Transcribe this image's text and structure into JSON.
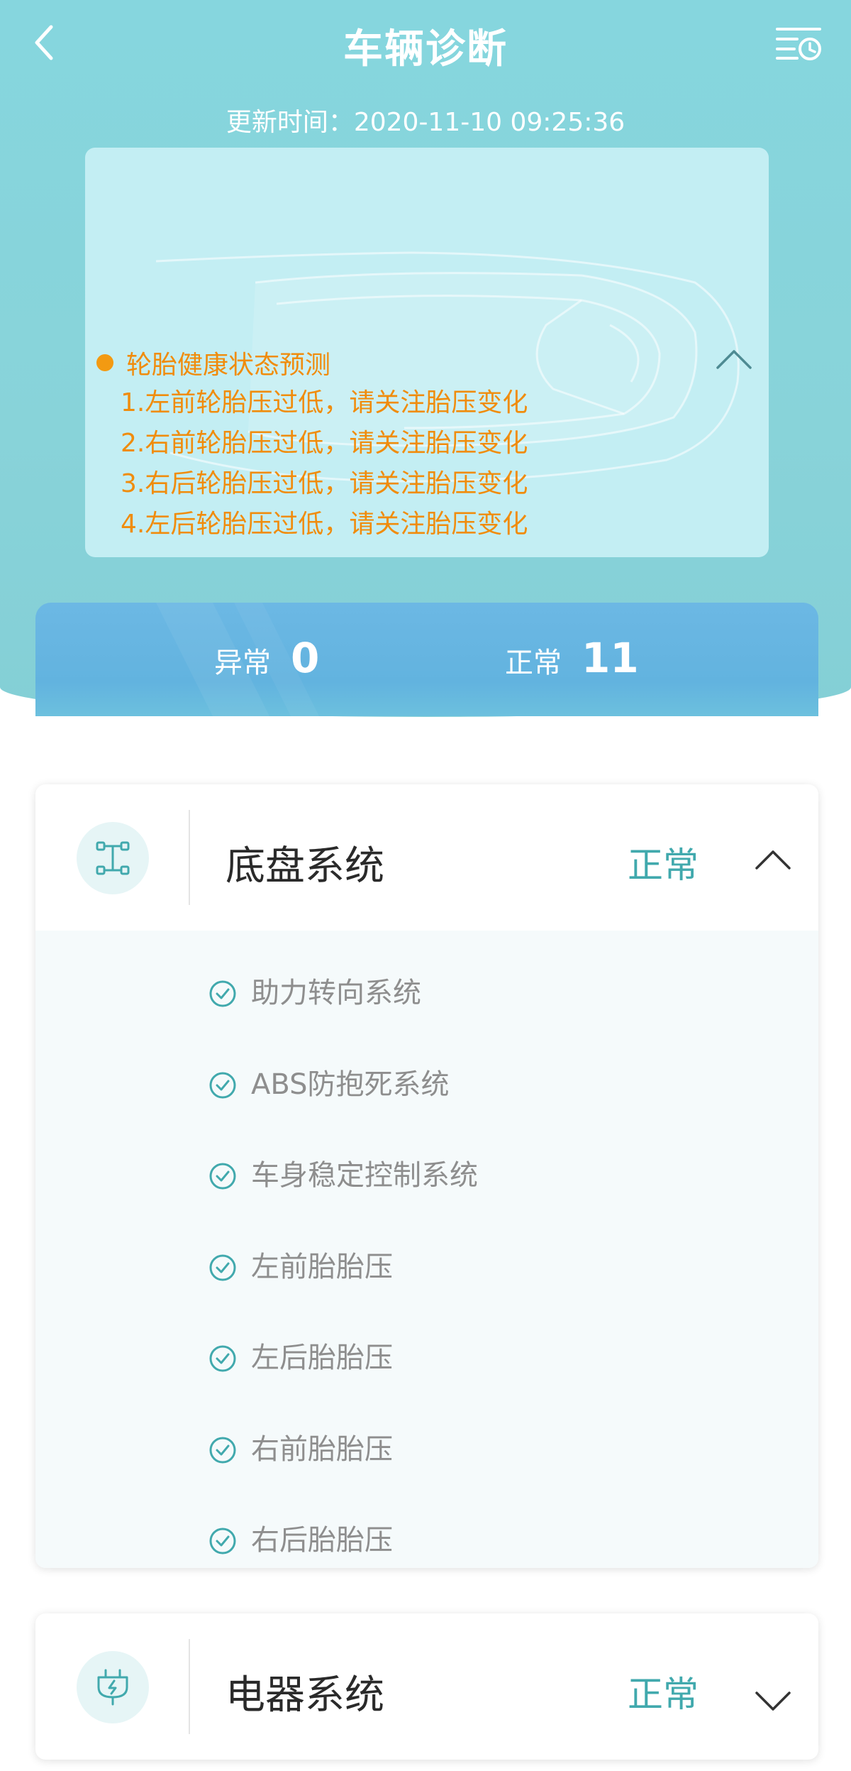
{
  "header": {
    "title": "车辆诊断",
    "back_icon": "back-arrow-icon",
    "history_icon": "history-list-icon"
  },
  "update": {
    "label": "更新时间：",
    "value": "2020-11-10 09:25:36"
  },
  "alert": {
    "title": "轮胎健康状态预测",
    "lines": [
      "1.左前轮胎压过低，请关注胎压变化",
      "2.右前轮胎压过低，请关注胎压变化",
      "3.右后轮胎压过低，请关注胎压变化",
      "4.左后轮胎压过低，请关注胎压变化"
    ],
    "collapse_icon": "chevron-up-icon"
  },
  "summary": {
    "abnormal_label": "异常",
    "abnormal_count": "0",
    "normal_label": "正常",
    "normal_count": "11"
  },
  "sections": [
    {
      "name": "底盘系统",
      "status": "正常",
      "icon": "chassis-icon",
      "expanded": true,
      "items": [
        "助力转向系统",
        "ABS防抱死系统",
        "车身稳定控制系统",
        "左前胎胎压",
        "左后胎胎压",
        "右前胎胎压",
        "右后胎胎压"
      ]
    },
    {
      "name": "电器系统",
      "status": "正常",
      "icon": "electric-plug-icon",
      "expanded": false,
      "items": []
    }
  ],
  "colors": {
    "header_bg": "#86d6de",
    "alert_text": "#f08c0c",
    "status_normal": "#41a9ad",
    "summary_bg": "#64b4e0"
  }
}
